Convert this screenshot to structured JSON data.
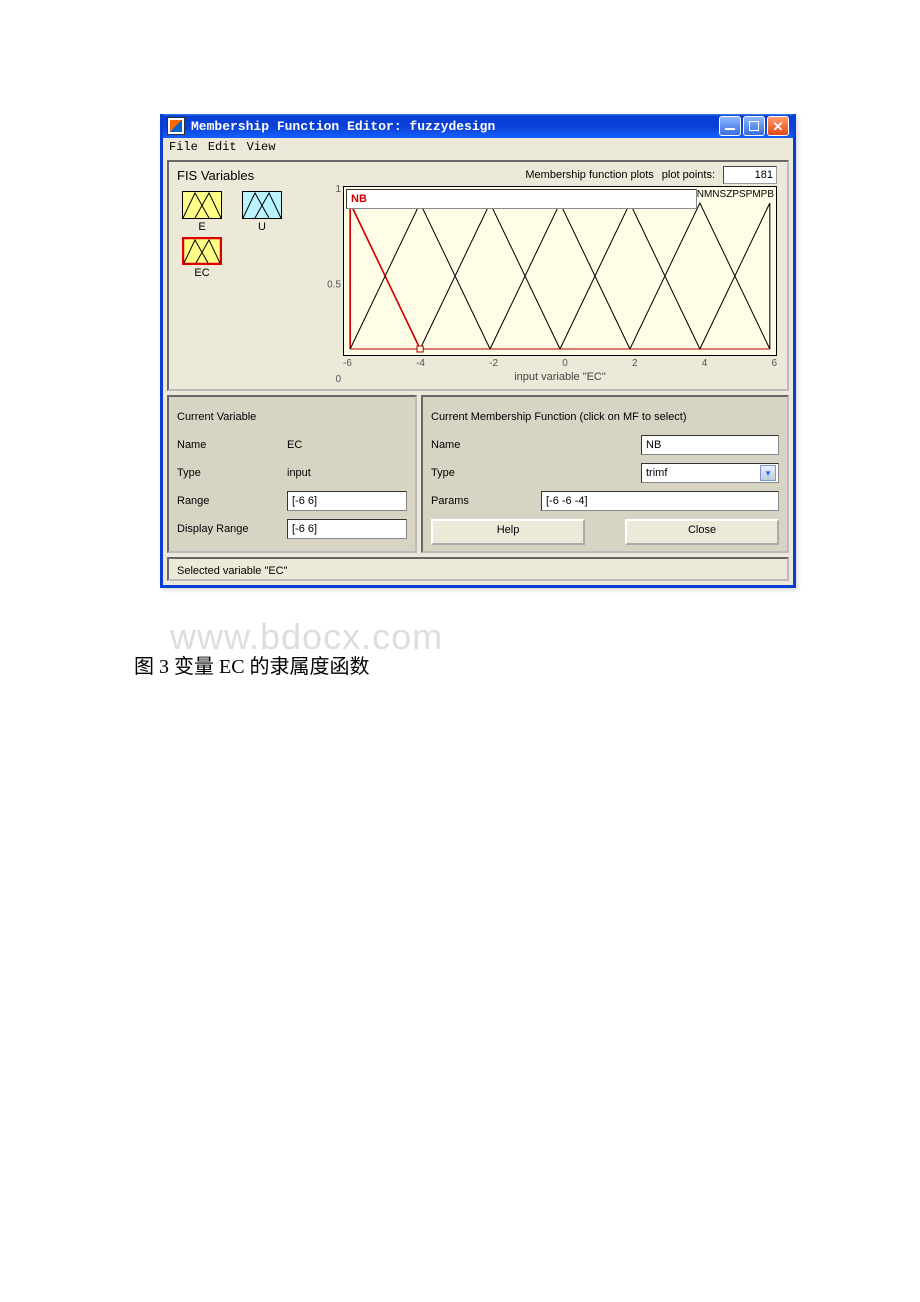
{
  "window": {
    "title": "Membership Function Editor: fuzzydesign"
  },
  "menu": {
    "file": "File",
    "edit": "Edit",
    "view": "View"
  },
  "fis": {
    "heading": "FIS Variables",
    "vars": {
      "E_label": "E",
      "U_label": "U",
      "EC_label": "EC"
    }
  },
  "plot": {
    "header_label": "Membership function plots",
    "plot_points_label": "plot points:",
    "plot_points_value": "181",
    "xlabel": "input variable \"EC\""
  },
  "chart_data": {
    "type": "line",
    "title": "Membership function plots",
    "xlabel": "input variable \"EC\"",
    "ylabel": "",
    "xlim": [
      -6,
      6
    ],
    "ylim": [
      0,
      1
    ],
    "xticks": [
      -6,
      -4,
      -2,
      0,
      2,
      4,
      6
    ],
    "yticks": [
      0,
      0.5,
      1
    ],
    "selected_series": "NB",
    "series": [
      {
        "name": "NB",
        "x": [
          -6,
          -6,
          -4
        ],
        "y": [
          0,
          1,
          0
        ],
        "color": "#cc0000"
      },
      {
        "name": "NM",
        "x": [
          -6,
          -4,
          -2
        ],
        "y": [
          0,
          1,
          0
        ],
        "color": "#000000"
      },
      {
        "name": "NS",
        "x": [
          -4,
          -2,
          0
        ],
        "y": [
          0,
          1,
          0
        ],
        "color": "#000000"
      },
      {
        "name": "Z",
        "x": [
          -2,
          0,
          2
        ],
        "y": [
          0,
          1,
          0
        ],
        "color": "#000000"
      },
      {
        "name": "PS",
        "x": [
          0,
          2,
          4
        ],
        "y": [
          0,
          1,
          0
        ],
        "color": "#000000"
      },
      {
        "name": "PM",
        "x": [
          2,
          4,
          6
        ],
        "y": [
          0,
          1,
          0
        ],
        "color": "#000000"
      },
      {
        "name": "PB",
        "x": [
          4,
          6,
          6
        ],
        "y": [
          0,
          1,
          0
        ],
        "color": "#000000"
      }
    ]
  },
  "current_var": {
    "heading": "Current Variable",
    "name_label": "Name",
    "name_value": "EC",
    "type_label": "Type",
    "type_value": "input",
    "range_label": "Range",
    "range_value": "[-6 6]",
    "drange_label": "Display Range",
    "drange_value": "[-6 6]"
  },
  "current_mf": {
    "heading": "Current Membership Function (click on MF to select)",
    "name_label": "Name",
    "name_value": "NB",
    "type_label": "Type",
    "type_value": "trimf",
    "params_label": "Params",
    "params_value": "[-6 -6 -4]",
    "help_label": "Help",
    "close_label": "Close"
  },
  "status": {
    "text": "Selected variable \"EC\""
  },
  "caption": "图 3 变量 EC 的隶属度函数",
  "watermark": "www.bdocx.com"
}
